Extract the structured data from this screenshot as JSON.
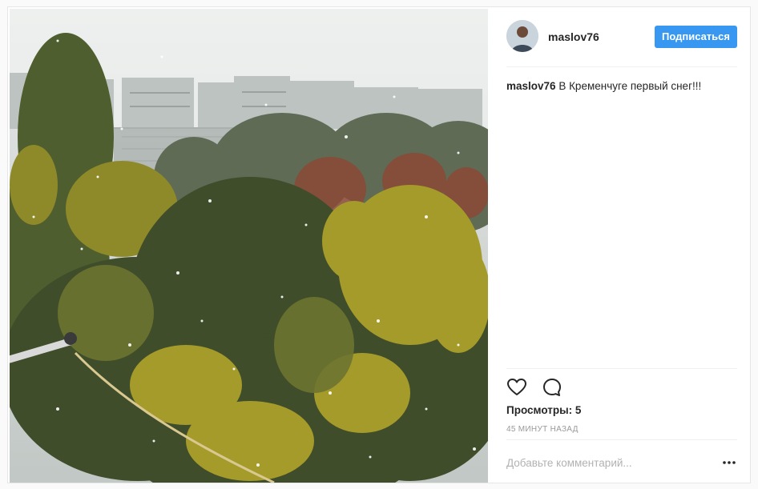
{
  "post": {
    "author": {
      "username": "maslov76"
    },
    "follow_label": "Подписаться",
    "caption": {
      "username": "maslov76",
      "text": "В Кременчуге первый снег!!!"
    },
    "views_label": "Просмотры: 5",
    "timestamp": "45 минут назад",
    "comment_placeholder": "Добавьте комментарий...",
    "icons": {
      "like": "heart-icon",
      "comment": "comment-icon",
      "more": "more-options-icon"
    }
  },
  "colors": {
    "accent": "#3897f0",
    "text": "#262626",
    "muted": "#999999",
    "border": "#efefef"
  }
}
